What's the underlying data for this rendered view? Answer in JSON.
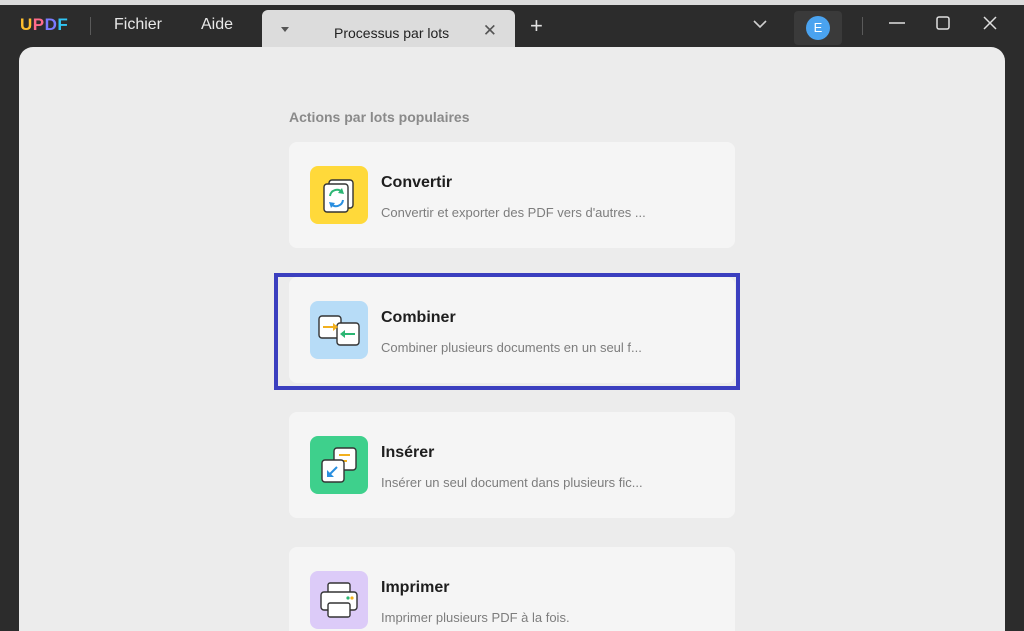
{
  "app": {
    "logo_letters": [
      "U",
      "P",
      "D",
      "F"
    ]
  },
  "menu": {
    "file": "Fichier",
    "help": "Aide"
  },
  "tab": {
    "title": "Processus par lots",
    "close_symbol": "✕",
    "add_symbol": "+"
  },
  "user": {
    "avatar_initial": "E"
  },
  "content": {
    "section_title": "Actions par lots populaires",
    "cards": [
      {
        "title": "Convertir",
        "desc": "Convertir et exporter des PDF vers d'autres ...",
        "icon": "convert-icon",
        "color": "#ffd93a"
      },
      {
        "title": "Combiner",
        "desc": "Combiner plusieurs documents en un seul f...",
        "icon": "combine-icon",
        "color": "#b7dcf7"
      },
      {
        "title": "Insérer",
        "desc": "Insérer un seul document dans plusieurs fic...",
        "icon": "insert-icon",
        "color": "#3ed08c"
      },
      {
        "title": "Imprimer",
        "desc": "Imprimer plusieurs PDF à la fois.",
        "icon": "print-icon",
        "color": "#dccbf8"
      }
    ]
  },
  "colors": {
    "highlight_border": "#3b3fbf",
    "accent_blue": "#4aa3f0"
  }
}
